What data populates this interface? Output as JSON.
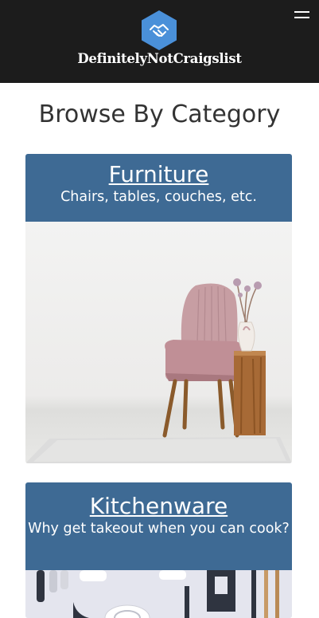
{
  "header": {
    "brand": "DefinitelyNotCraigslist",
    "logo_icon": "handshake-hexagon-icon",
    "menu_icon": "hamburger-menu-icon",
    "colors": {
      "background": "#1c1c1c",
      "logo": "#4a90d9"
    }
  },
  "main": {
    "title": "Browse By Category",
    "categories": [
      {
        "name": "Furniture",
        "description": "Chairs, tables, couches, etc.",
        "image_icon": "pink-armchair-photo"
      },
      {
        "name": "Kitchenware",
        "description": "Why get takeout when you can cook?",
        "image_icon": "kitchen-utensils-photo"
      }
    ],
    "colors": {
      "card_header": "#3e6a94"
    }
  }
}
